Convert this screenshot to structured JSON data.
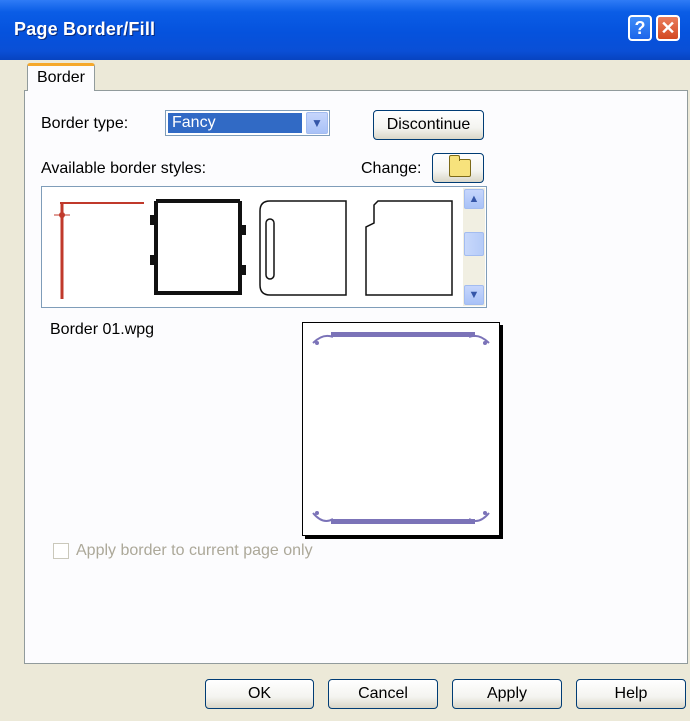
{
  "window": {
    "title": "Page Border/Fill"
  },
  "titlebar_buttons": {
    "help": "?",
    "close": "✕"
  },
  "tabs": [
    {
      "label": "Border"
    }
  ],
  "border_type": {
    "label": "Border type:",
    "value": "Fancy"
  },
  "buttons": {
    "discontinue": "Discontinue",
    "ok": "OK",
    "cancel": "Cancel",
    "apply": "Apply",
    "help": "Help"
  },
  "styles": {
    "label": "Available border styles:",
    "change_label": "Change:"
  },
  "selected": {
    "filename": "Border 01.wpg"
  },
  "apply_current_page": {
    "label": "Apply border to current page only",
    "checked": false,
    "enabled": false
  },
  "icons": {
    "dropdown": "chevron-down-icon",
    "folder": "folder-icon",
    "scroll_up": "chevron-up-icon",
    "scroll_down": "chevron-down-icon"
  },
  "colors": {
    "titlebar": "#0552dd",
    "selection": "#316ac5",
    "tab_accent": "#f5a82b",
    "border_accent": "#c0392b",
    "preview_border": "#7b73b8"
  }
}
